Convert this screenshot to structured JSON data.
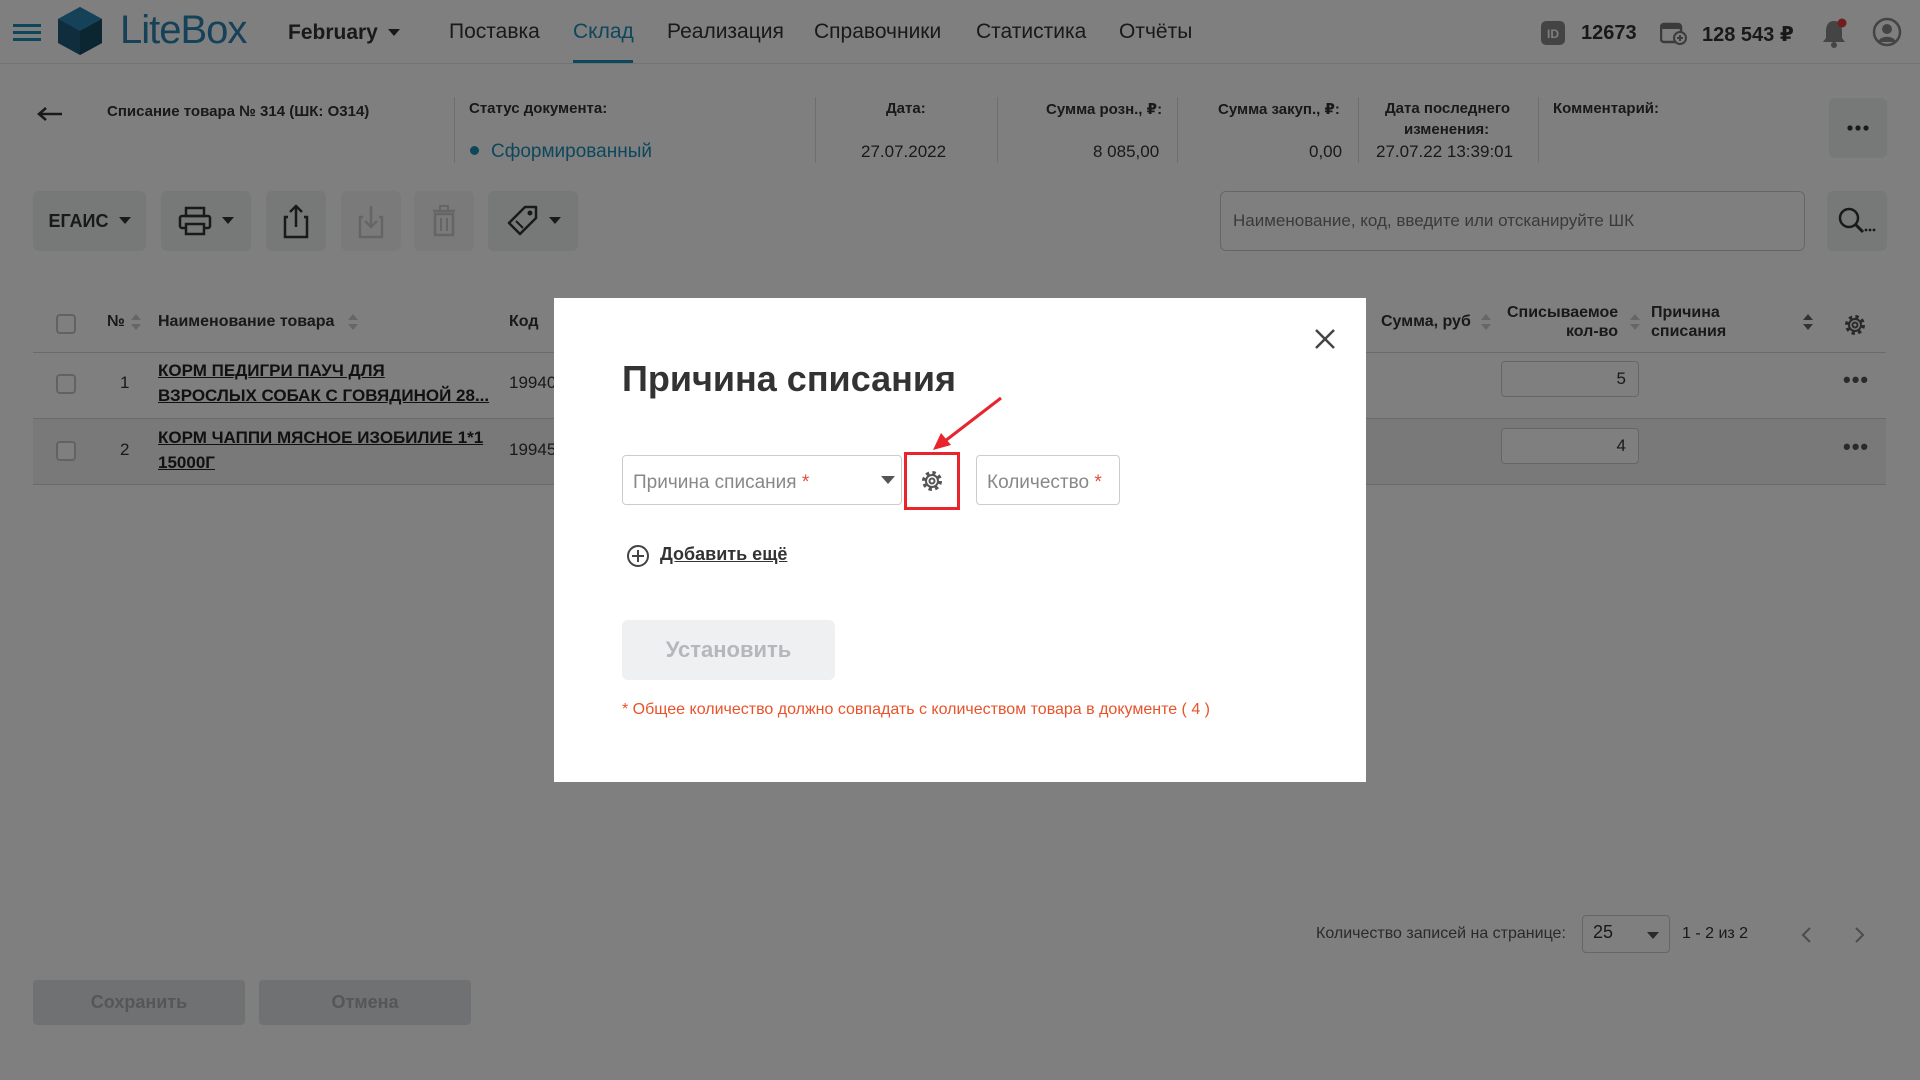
{
  "topbar": {
    "brand": "LiteBox",
    "store": "February",
    "nav": [
      "Поставка",
      "Склад",
      "Реализация",
      "Справочники",
      "Статистика",
      "Отчёты"
    ],
    "active_nav": "Склад",
    "id_value": "12673",
    "balance": "128 543 ₽",
    "accent_color": "#1b8fb8"
  },
  "doc": {
    "title": "Списание товара № 314 (ШК: О314)",
    "status_label": "Статус документа:",
    "status_value": "Сформированный",
    "date_label": "Дата:",
    "date_value": "27.07.2022",
    "retail_label": "Сумма розн., ₽:",
    "retail_value": "8 085,00",
    "purchase_label": "Сумма закуп., ₽:",
    "purchase_value": "0,00",
    "changed_label_1": "Дата последнего",
    "changed_label_2": "изменения:",
    "changed_value": "27.07.22 13:39:01",
    "comment_label": "Комментарий:"
  },
  "toolbar": {
    "egais_label": "ЕГАИС",
    "search_placeholder": "Наименование, код, введите или отсканируйте ШК"
  },
  "table": {
    "headers": {
      "num": "№",
      "name": "Наименование товара",
      "code": "Код",
      "sum": "Сумма, руб",
      "qty_1": "Списываемое",
      "qty_2": "кол-во",
      "reason_1": "Причина",
      "reason_2": "списания"
    },
    "rows": [
      {
        "num": "1",
        "name_1": "КОРМ ПЕДИГРИ ПАУЧ ДЛЯ",
        "name_2": "ВЗРОСЛЫХ СОБАК С ГОВЯДИНОЙ 28...",
        "code": "19940",
        "qty": "5"
      },
      {
        "num": "2",
        "name_1": "КОРМ ЧАППИ МЯСНОЕ ИЗОБИЛИЕ 1*1",
        "name_2": "15000Г",
        "code": "19945",
        "qty": "4"
      }
    ]
  },
  "pagination": {
    "per_page_label": "Количество записей на странице:",
    "per_page_value": "25",
    "range": "1 - 2 из 2"
  },
  "footer": {
    "save_label": "Сохранить",
    "cancel_label": "Отмена"
  },
  "modal": {
    "title": "Причина списания",
    "reason_placeholder": "Причина списания",
    "qty_placeholder": "Количество",
    "required_mark": "*",
    "add_more_label": "Добавить ещё",
    "submit_label": "Установить",
    "note": "* Общее количество должно совпадать с количеством товара в документе ( 4 )",
    "highlight_color": "#e8242c"
  }
}
